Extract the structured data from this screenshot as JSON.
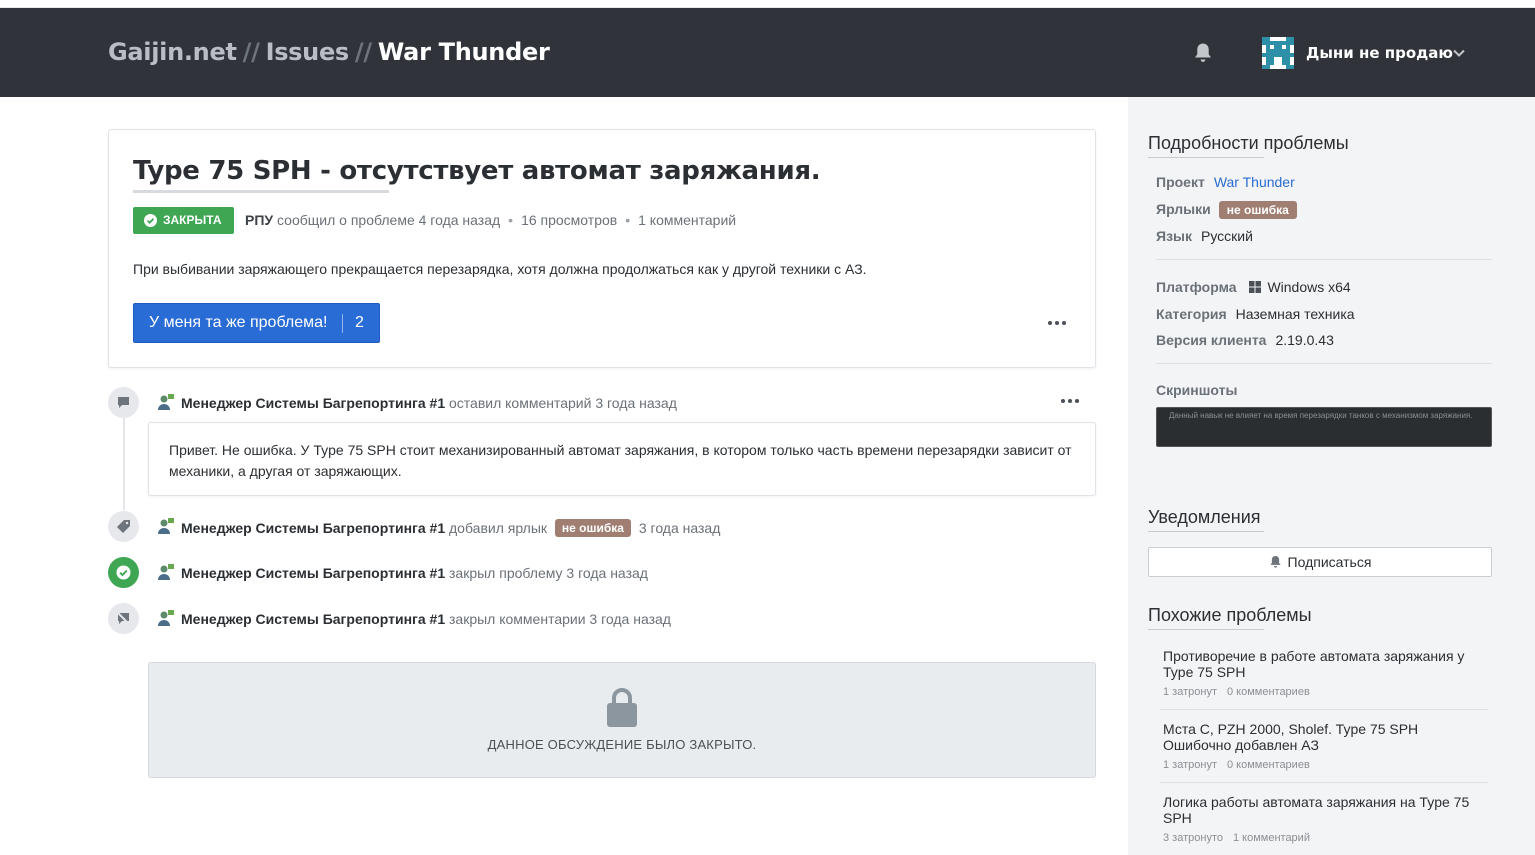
{
  "header": {
    "brand_site": "Gaijin.net",
    "separator": "//",
    "brand_section": "Issues",
    "brand_project": "War Thunder",
    "username": "Дыни не продаю"
  },
  "issue": {
    "title": "Type 75 SPH - отсутствует автомат заряжания.",
    "status": "ЗАКРЫТА",
    "author": "РПУ",
    "reported_text": "сообщил о проблеме 4 года назад",
    "views": "16 просмотров",
    "comments": "1 комментарий",
    "description": "При выбивании заряжающего прекращается перезарядка, хотя должна продолжаться как у другой техники с АЗ.",
    "same_problem_label": "У меня та же проблема!",
    "same_problem_count": "2"
  },
  "timeline": {
    "comment": {
      "author": "Менеджер Системы Багрепортинга #1",
      "action": "оставил комментарий 3 года назад",
      "text": "Привет. Не ошибка. У Type 75 SPH стоит механизированный автомат заряжания, в котором только часть времени перезарядки зависит от механики, а другая от заряжающих."
    },
    "label_event": {
      "author": "Менеджер Системы Багрепортинга #1",
      "action": "добавил ярлык",
      "tag": "не ошибка",
      "time": "3 года назад"
    },
    "close_event": {
      "author": "Менеджер Системы Багрепортинга #1",
      "action": "закрыл проблему 3 года назад"
    },
    "lock_event": {
      "author": "Менеджер Системы Багрепортинга #1",
      "action": "закрыл комментарии 3 года назад"
    },
    "locked_notice": "ДАННОЕ ОБСУЖДЕНИЕ БЫЛО ЗАКРЫТО."
  },
  "sidebar": {
    "details_title": "Подробности проблемы",
    "project_key": "Проект",
    "project_value": "War Thunder",
    "labels_key": "Ярлыки",
    "labels_value": "не ошибка",
    "language_key": "Язык",
    "language_value": "Русский",
    "platform_key": "Платформа",
    "platform_value": "Windows x64",
    "category_key": "Категория",
    "category_value": "Наземная техника",
    "version_key": "Версия клиента",
    "version_value": "2.19.0.43",
    "screenshots_key": "Скриншоты",
    "screenshot_caption": "Данный навык не влияет на время перезарядки танков с механизмом заряжания.",
    "notifications_title": "Уведомления",
    "subscribe_label": "Подписаться",
    "similar_title": "Похожие проблемы",
    "similar": [
      {
        "title": "Противоречие в работе автомата заряжания у Type 75 SPH",
        "affected": "1 затронут",
        "comments": "0 комментариев"
      },
      {
        "title": "Мста С, PZH 2000, Sholef. Type 75 SPH Ошибочно добавлен АЗ",
        "affected": "1 затронут",
        "comments": "0 комментариев"
      },
      {
        "title": "Логика работы автомата заряжания на Type 75 SPH",
        "affected": "3 затронуто",
        "comments": "1 комментарий"
      }
    ]
  },
  "colors": {
    "header_bg": "#30343a",
    "accent_blue": "#2a6cd5",
    "status_green": "#3fa654",
    "tag_brown": "#a07f72",
    "sidebar_bg": "#f3f4f6"
  }
}
